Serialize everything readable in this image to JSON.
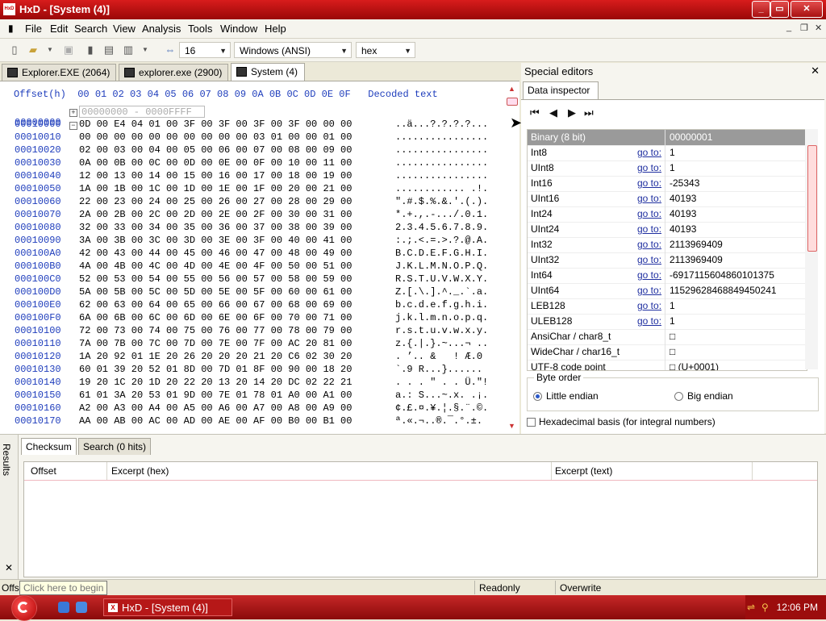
{
  "window": {
    "title": "HxD - [System (4)]",
    "app_icon_text": "HxD"
  },
  "menu": [
    "File",
    "Edit",
    "Search",
    "View",
    "Analysis",
    "Tools",
    "Window",
    "Help"
  ],
  "toolbar": {
    "bytes_per_row": "16",
    "charset": "Windows (ANSI)",
    "offset_base": "hex"
  },
  "tabs": [
    {
      "label": "Explorer.EXE (2064)",
      "active": false
    },
    {
      "label": "explorer.exe (2900)",
      "active": false
    },
    {
      "label": "System (4)",
      "active": true
    }
  ],
  "hex_view": {
    "header": "Offset(h)  00 01 02 03 04 05 06 07 08 09 0A 0B 0C 0D 0E 0F   Decoded text",
    "collapsed_region": {
      "offset": "00000000",
      "range": "00000000 - 0000FFFF"
    },
    "rows": [
      {
        "offset": "00010000",
        "hex": "0D 00 E4 04 01 00 3F 00 3F 00 3F 00 3F 00 00 00",
        "text": "..ä...?.?.?.?..."
      },
      {
        "offset": "00010010",
        "hex": "00 00 00 00 00 00 00 00 00 00 03 01 00 00 01 00",
        "text": "................"
      },
      {
        "offset": "00010020",
        "hex": "02 00 03 00 04 00 05 00 06 00 07 00 08 00 09 00",
        "text": "................"
      },
      {
        "offset": "00010030",
        "hex": "0A 00 0B 00 0C 00 0D 00 0E 00 0F 00 10 00 11 00",
        "text": "................"
      },
      {
        "offset": "00010040",
        "hex": "12 00 13 00 14 00 15 00 16 00 17 00 18 00 19 00",
        "text": "................"
      },
      {
        "offset": "00010050",
        "hex": "1A 00 1B 00 1C 00 1D 00 1E 00 1F 00 20 00 21 00",
        "text": "............ .!."
      },
      {
        "offset": "00010060",
        "hex": "22 00 23 00 24 00 25 00 26 00 27 00 28 00 29 00",
        "text": "\".#.$.%.&.'.(.)."
      },
      {
        "offset": "00010070",
        "hex": "2A 00 2B 00 2C 00 2D 00 2E 00 2F 00 30 00 31 00",
        "text": "*.+.,.-.../.0.1."
      },
      {
        "offset": "00010080",
        "hex": "32 00 33 00 34 00 35 00 36 00 37 00 38 00 39 00",
        "text": "2.3.4.5.6.7.8.9."
      },
      {
        "offset": "00010090",
        "hex": "3A 00 3B 00 3C 00 3D 00 3E 00 3F 00 40 00 41 00",
        "text": ":.;.<.=.>.?.@.A."
      },
      {
        "offset": "000100A0",
        "hex": "42 00 43 00 44 00 45 00 46 00 47 00 48 00 49 00",
        "text": "B.C.D.E.F.G.H.I."
      },
      {
        "offset": "000100B0",
        "hex": "4A 00 4B 00 4C 00 4D 00 4E 00 4F 00 50 00 51 00",
        "text": "J.K.L.M.N.O.P.Q."
      },
      {
        "offset": "000100C0",
        "hex": "52 00 53 00 54 00 55 00 56 00 57 00 58 00 59 00",
        "text": "R.S.T.U.V.W.X.Y."
      },
      {
        "offset": "000100D0",
        "hex": "5A 00 5B 00 5C 00 5D 00 5E 00 5F 00 60 00 61 00",
        "text": "Z.[.\\.].^._.`.a."
      },
      {
        "offset": "000100E0",
        "hex": "62 00 63 00 64 00 65 00 66 00 67 00 68 00 69 00",
        "text": "b.c.d.e.f.g.h.i."
      },
      {
        "offset": "000100F0",
        "hex": "6A 00 6B 00 6C 00 6D 00 6E 00 6F 00 70 00 71 00",
        "text": "j.k.l.m.n.o.p.q."
      },
      {
        "offset": "00010100",
        "hex": "72 00 73 00 74 00 75 00 76 00 77 00 78 00 79 00",
        "text": "r.s.t.u.v.w.x.y."
      },
      {
        "offset": "00010110",
        "hex": "7A 00 7B 00 7C 00 7D 00 7E 00 7F 00 AC 20 81 00",
        "text": "z.{.|.}.~...¬ .."
      },
      {
        "offset": "00010120",
        "hex": "1A 20 92 01 1E 20 26 20 20 20 21 20 C6 02 30 20",
        "text": ". ’.. &   ! Æ.0 "
      },
      {
        "offset": "00010130",
        "hex": "60 01 39 20 52 01 8D 00 7D 01 8F 00 90 00 18 20",
        "text": "`.9 R...}...... "
      },
      {
        "offset": "00010140",
        "hex": "19 20 1C 20 1D 20 22 20 13 20 14 20 DC 02 22 21",
        "text": ". . . \" . . Ü.\"!"
      },
      {
        "offset": "00010150",
        "hex": "61 01 3A 20 53 01 9D 00 7E 01 78 01 A0 00 A1 00",
        "text": "a.: S...~.x. .¡."
      },
      {
        "offset": "00010160",
        "hex": "A2 00 A3 00 A4 00 A5 00 A6 00 A7 00 A8 00 A9 00",
        "text": "¢.£.¤.¥.¦.§.¨.©."
      },
      {
        "offset": "00010170",
        "hex": "AA 00 AB 00 AC 00 AD 00 AE 00 AF 00 B0 00 B1 00",
        "text": "ª.«.¬.­.®.¯.°.±."
      }
    ]
  },
  "special_editors": {
    "title": "Special editors",
    "tab": "Data inspector",
    "rows": [
      {
        "name": "Binary (8 bit)",
        "goto": "",
        "value": "00000001",
        "selected": true
      },
      {
        "name": "Int8",
        "goto": "go to:",
        "value": "1"
      },
      {
        "name": "UInt8",
        "goto": "go to:",
        "value": "1"
      },
      {
        "name": "Int16",
        "goto": "go to:",
        "value": "-25343"
      },
      {
        "name": "UInt16",
        "goto": "go to:",
        "value": "40193"
      },
      {
        "name": "Int24",
        "goto": "go to:",
        "value": "40193"
      },
      {
        "name": "UInt24",
        "goto": "go to:",
        "value": "40193"
      },
      {
        "name": "Int32",
        "goto": "go to:",
        "value": "2113969409"
      },
      {
        "name": "UInt32",
        "goto": "go to:",
        "value": "2113969409"
      },
      {
        "name": "Int64",
        "goto": "go to:",
        "value": "-6917115604860101375"
      },
      {
        "name": "UInt64",
        "goto": "go to:",
        "value": "11529628468849450241"
      },
      {
        "name": "LEB128",
        "goto": "go to:",
        "value": "1"
      },
      {
        "name": "ULEB128",
        "goto": "go to:",
        "value": "1"
      },
      {
        "name": "AnsiChar / char8_t",
        "goto": "",
        "value": "□"
      },
      {
        "name": "WideChar / char16_t",
        "goto": "",
        "value": "□"
      },
      {
        "name": "UTF-8 code point",
        "goto": "",
        "value": "□ (U+0001)"
      }
    ],
    "byte_order": {
      "legend": "Byte order",
      "little": "Little endian",
      "big": "Big endian",
      "selected": "little"
    },
    "hex_basis_label": "Hexadecimal basis (for integral numbers)"
  },
  "results": {
    "side_label": "Results",
    "tabs": [
      "Checksum",
      "Search (0 hits)"
    ],
    "columns": [
      "Offset",
      "Excerpt (hex)",
      "Excerpt (text)"
    ]
  },
  "status": {
    "offset_label": "Offset: 10001",
    "tooltip": "Click here to begin",
    "readonly": "Readonly",
    "overwrite": "Overwrite"
  },
  "taskbar": {
    "task_label": "HxD - [System (4)]",
    "clock": "12:06 PM"
  },
  "colors": {
    "title_bar": "#c41414",
    "offset_text": "#1e3dbc",
    "taskbar": "#a81010"
  }
}
